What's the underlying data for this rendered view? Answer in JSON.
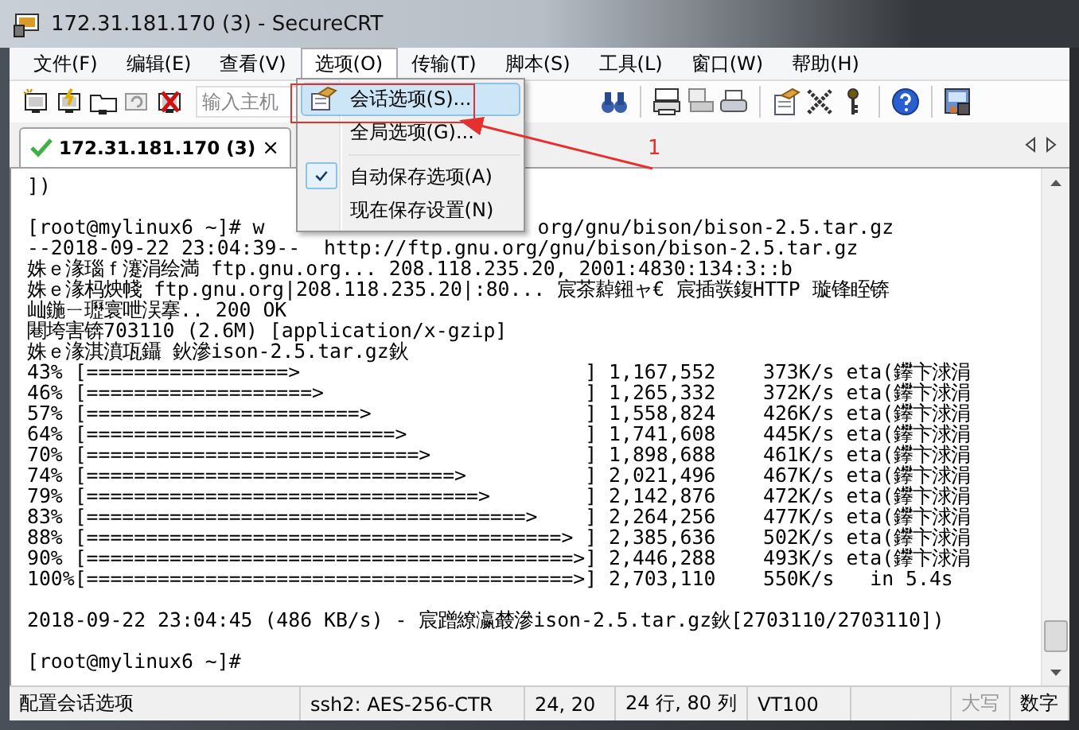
{
  "window": {
    "title": "172.31.181.170 (3) - SecureCRT"
  },
  "menu_bar": [
    {
      "label": "文件(F)",
      "selected": false
    },
    {
      "label": "编辑(E)",
      "selected": false
    },
    {
      "label": "查看(V)",
      "selected": false
    },
    {
      "label": "选项(O)",
      "selected": true
    },
    {
      "label": "传输(T)",
      "selected": false
    },
    {
      "label": "脚本(S)",
      "selected": false
    },
    {
      "label": "工具(L)",
      "selected": false
    },
    {
      "label": "窗口(W)",
      "selected": false
    },
    {
      "label": "帮助(H)",
      "selected": false
    }
  ],
  "open_menu": {
    "items": [
      {
        "kind": "item",
        "label": "会话选项(S)...",
        "selected": true,
        "checked": false
      },
      {
        "kind": "item",
        "label": "全局选项(G)...",
        "selected": false,
        "checked": false
      },
      {
        "kind": "separator"
      },
      {
        "kind": "item",
        "label": "自动保存选项(A)",
        "selected": false,
        "checked": true
      },
      {
        "kind": "item",
        "label": "现在保存设置(N)",
        "selected": false,
        "checked": false
      }
    ]
  },
  "toolbar": {
    "host_field": {
      "placeholder": "输入主机"
    }
  },
  "tabs": [
    {
      "label": "172.31.181.170 (3)",
      "selected": true,
      "connected": true,
      "close": "×"
    }
  ],
  "terminal": {
    "lines": [
      {
        "kind": "text",
        "text": "])"
      },
      {
        "kind": "blank"
      },
      {
        "kind": "split",
        "left": "[root@mylinux6 ~]# w",
        "right": "org/gnu/bison/bison-2.5.tar.gz"
      },
      {
        "kind": "text",
        "text": "--2018-09-22 23:04:39--  http://ftp.gnu.org/gnu/bison/bison-2.5.tar.gz"
      },
      {
        "kind": "text",
        "text": "姝ｅ湪瑙ｆ瀽涓绘満 ftp.gnu.org... 208.118.235.20, 2001:4830:134:3::b"
      },
      {
        "kind": "text",
        "text": "姝ｅ湪杩炴帴 ftp.gnu.org|208.118.235.20|:80... 宸茶繛鎺ャ€ 宸插彂鍑HTTP 璇锋眰锛"
      },
      {
        "kind": "text",
        "text": "屾鍦ㄧ瓑寰呭洖搴.. 200 OK"
      },
      {
        "kind": "text",
        "text": "闀垮害锛703110 (2.6M) [application/x-gzip]"
      },
      {
        "kind": "text",
        "text": "姝ｅ湪淇濆瓨鑷 鈥滲ison-2.5.tar.gz鈥"
      },
      {
        "kind": "text",
        "text": "43% [=================>                        ] 1,167,552    373K/s eta(鑻卞浗涓"
      },
      {
        "kind": "text",
        "text": "46% [===================>                      ] 1,265,332    372K/s eta(鑻卞浗涓"
      },
      {
        "kind": "text",
        "text": "57% [=======================>                  ] 1,558,824    426K/s eta(鑻卞浗涓"
      },
      {
        "kind": "text",
        "text": "64% [==========================>               ] 1,741,608    445K/s eta(鑻卞浗涓"
      },
      {
        "kind": "text",
        "text": "70% [============================>             ] 1,898,688    461K/s eta(鑻卞浗涓"
      },
      {
        "kind": "text",
        "text": "74% [===============================>          ] 2,021,496    467K/s eta(鑻卞浗涓"
      },
      {
        "kind": "text",
        "text": "79% [=================================>        ] 2,142,876    472K/s eta(鑻卞浗涓"
      },
      {
        "kind": "text",
        "text": "83% [=====================================>    ] 2,264,256    477K/s eta(鑻卞浗涓"
      },
      {
        "kind": "text",
        "text": "88% [========================================> ] 2,385,636    502K/s eta(鑻卞浗涓"
      },
      {
        "kind": "text",
        "text": "90% [=========================================>] 2,446,288    493K/s eta(鑻卞浗涓"
      },
      {
        "kind": "text",
        "text": "100%[=========================================>] 2,703,110    550K/s   in 5.4s"
      },
      {
        "kind": "blank"
      },
      {
        "kind": "text",
        "text": "2018-09-22 23:04:45 (486 KB/s) - 宸蹭繚瀛樷滲ison-2.5.tar.gz鈥[2703110/2703110])"
      },
      {
        "kind": "blank"
      },
      {
        "kind": "text",
        "text": "[root@mylinux6 ~]#"
      }
    ]
  },
  "status_bar": [
    {
      "kind": "field",
      "text": "配置会话选项",
      "disabled": false
    },
    {
      "kind": "field",
      "text": "ssh2: AES-256-CTR",
      "disabled": false
    },
    {
      "kind": "field",
      "text": "24,  20",
      "disabled": false
    },
    {
      "kind": "field",
      "text": "24 行, 80 列",
      "disabled": false
    },
    {
      "kind": "field",
      "text": "VT100",
      "disabled": false
    },
    {
      "kind": "indicator",
      "text": "大写",
      "disabled": true
    },
    {
      "kind": "indicator",
      "text": "数字",
      "disabled": false
    }
  ],
  "annotation": {
    "label": "1"
  }
}
